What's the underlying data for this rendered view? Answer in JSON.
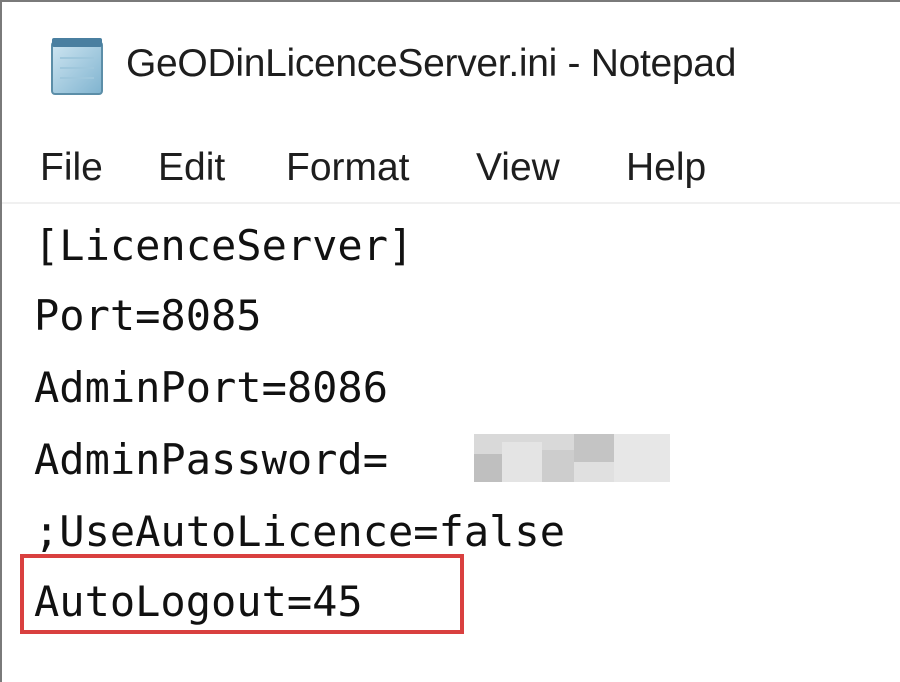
{
  "window": {
    "title": "GeODinLicenceServer.ini - Notepad",
    "app_icon": "notepad-icon"
  },
  "menu": {
    "items": [
      "File",
      "Edit",
      "Format",
      "View",
      "Help"
    ]
  },
  "editor": {
    "lines": [
      "[LicenceServer]",
      "Port=8085",
      "AdminPort=8086",
      "AdminPassword=",
      ";UseAutoLicence=false",
      "AutoLogout=45"
    ],
    "redacted_value": "obscured-password",
    "highlighted_line_index": 5
  },
  "colors": {
    "highlight_border": "#d9403f",
    "text": "#111111",
    "window_border": "#7a7a7a"
  }
}
